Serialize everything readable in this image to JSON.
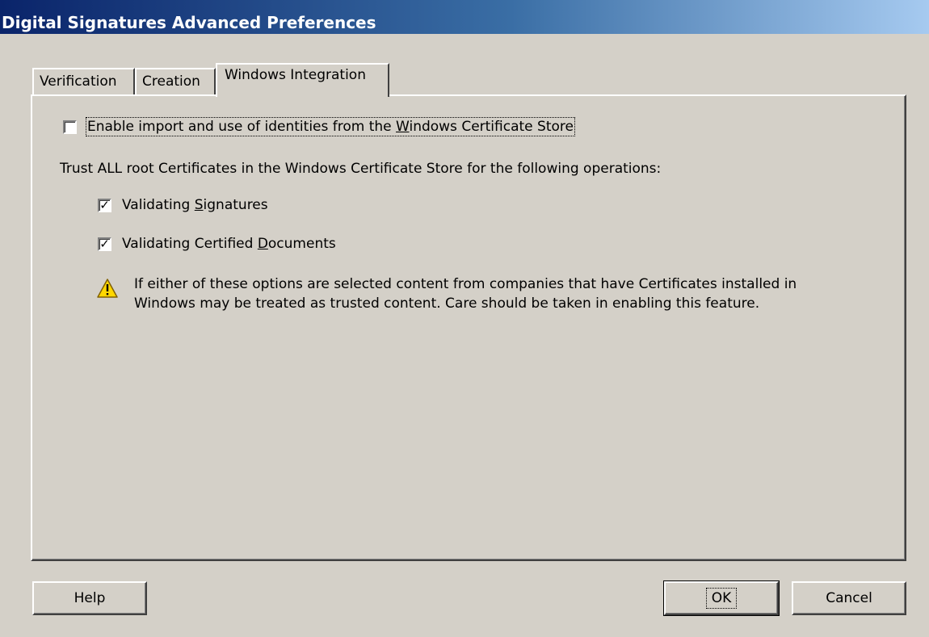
{
  "window": {
    "title": "Digital Signatures Advanced Preferences"
  },
  "tabs": [
    {
      "label": "Verification",
      "active": false
    },
    {
      "label": "Creation",
      "active": false
    },
    {
      "label": "Windows Integration",
      "active": true
    }
  ],
  "panel": {
    "enable_import": {
      "label_pre": "Enable import and use of identities from the ",
      "label_mnemonic": "W",
      "label_post": "indows Certificate Store",
      "checked": false
    },
    "trust_heading": "Trust ALL root Certificates in the Windows Certificate Store for the following operations:",
    "validating_signatures": {
      "label_pre": "Validating ",
      "label_mnemonic": "S",
      "label_post": "ignatures",
      "checked": true
    },
    "validating_certified": {
      "label_pre": "Validating Certified ",
      "label_mnemonic": "D",
      "label_post": "ocuments",
      "checked": true
    },
    "warning": {
      "icon": "warning-triangle-icon",
      "line1": "If either of these options are selected content from companies that have Certificates installed in",
      "line2": "Windows may be treated as trusted content. Care should be taken in enabling this feature."
    }
  },
  "buttons": {
    "help": "Help",
    "ok": "OK",
    "cancel": "Cancel"
  },
  "colors": {
    "title_gradient_start": "#0a246a",
    "title_gradient_end": "#a6caf0",
    "face": "#d4d0c8",
    "warning_yellow": "#ffd700"
  }
}
